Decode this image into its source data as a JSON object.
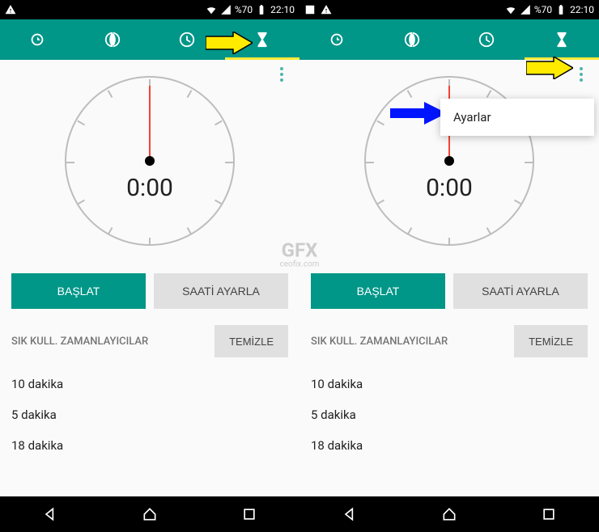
{
  "statusbar": {
    "battery_pct": "%70",
    "time": "22:10"
  },
  "tabs": {
    "names": [
      "alarm",
      "world-clock",
      "clock",
      "timer"
    ]
  },
  "timer": {
    "display": "0:00"
  },
  "buttons": {
    "start": "BAŞLAT",
    "set_time": "SAATİ AYARLA",
    "clear": "TEMİZLE"
  },
  "recent": {
    "label": "SIK KULL. ZAMANLAYICILAR",
    "items": [
      "10 dakika",
      "5 dakika",
      "18 dakika"
    ]
  },
  "popup": {
    "settings": "Ayarlar"
  },
  "watermark": {
    "brand": "GFX",
    "site": "ceofix.com"
  }
}
